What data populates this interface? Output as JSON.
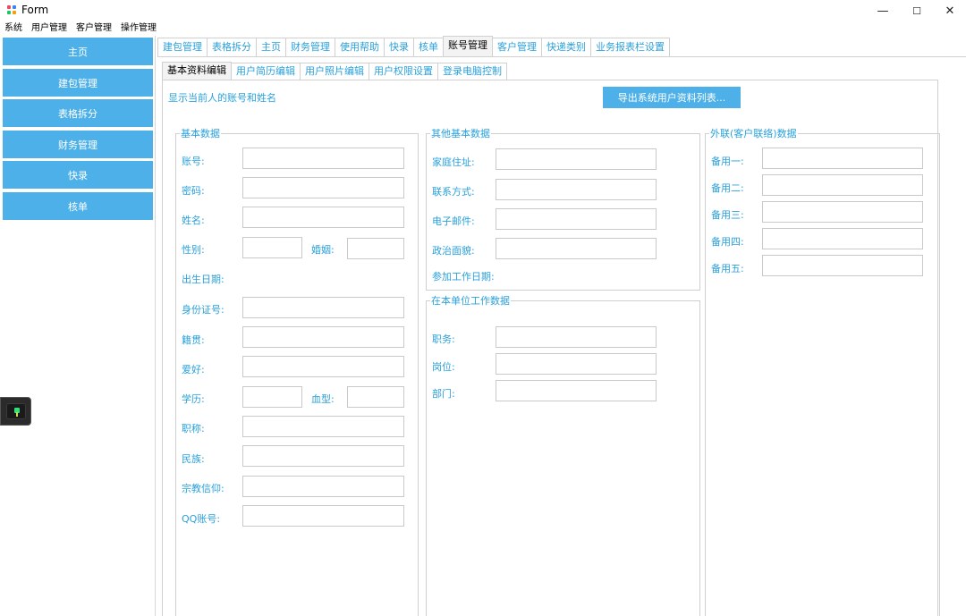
{
  "window": {
    "title": "Form",
    "minimize": "—",
    "maximize": "☐",
    "close": "✕"
  },
  "menu": [
    "系统",
    "用户管理",
    "客户管理",
    "操作管理"
  ],
  "sidebar": {
    "items": [
      "主页",
      "建包管理",
      "表格拆分",
      "财务管理",
      "快录",
      "核单"
    ]
  },
  "top_tabs": [
    "建包管理",
    "表格拆分",
    "主页",
    "财务管理",
    "使用帮助",
    "快录",
    "核单",
    "账号管理",
    "客户管理",
    "快递类别",
    "业务报表栏设置"
  ],
  "top_tabs_active_index": 7,
  "sub_tabs": [
    "基本资料编辑",
    "用户简历编辑",
    "用户照片编辑",
    "用户权限设置",
    "登录电脑控制"
  ],
  "sub_tabs_active_index": 0,
  "panel": {
    "current_user_label": "显示当前人的账号和姓名",
    "export_button": "导出系统用户资料列表..."
  },
  "basic": {
    "title": "基本数据",
    "account": "账号:",
    "password": "密码:",
    "name": "姓名:",
    "gender": "性别:",
    "marriage": "婚姻:",
    "birth_date": "出生日期:",
    "id_number": "身份证号:",
    "native_place": "籍贯:",
    "hobby": "爱好:",
    "education": "学历:",
    "blood_type": "血型:",
    "job_title": "职称:",
    "ethnicity": "民族:",
    "religion": "宗教信仰:",
    "qq": "QQ账号:"
  },
  "other": {
    "title": "其他基本数据",
    "address": "家庭住址:",
    "contact": "联系方式:",
    "email": "电子邮件:",
    "political": "政治面貌:",
    "work_start": "参加工作日期:"
  },
  "work": {
    "title": "在本单位工作数据",
    "position": "职务:",
    "post": "岗位:",
    "department": "部门:"
  },
  "external": {
    "title": "外联(客户联络)数据",
    "spare1": "备用一:",
    "spare2": "备用二:",
    "spare3": "备用三:",
    "spare4": "备用四:",
    "spare5": "备用五:"
  },
  "colors": {
    "accent": "#4db0e8",
    "label": "#2aa1db",
    "border": "#cfcfcf"
  }
}
